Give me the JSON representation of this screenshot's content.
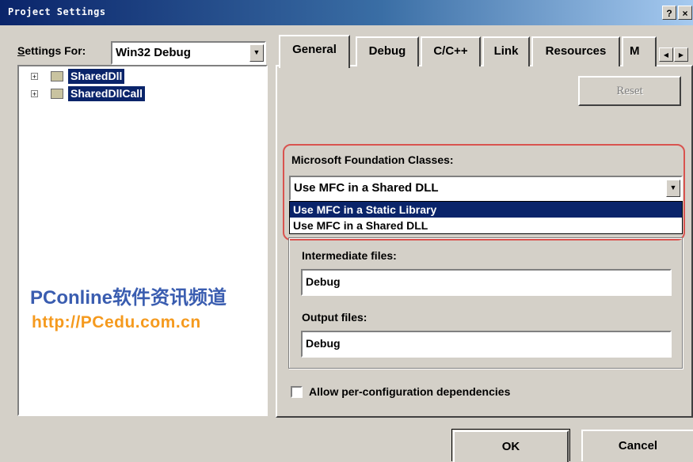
{
  "window": {
    "title": "Project Settings",
    "help_label": "?",
    "close_label": "×"
  },
  "left": {
    "settings_for_label": "Settings For:",
    "settings_for_value": "Win32 Debug",
    "tree": [
      {
        "label": "SharedDll"
      },
      {
        "label": "SharedDllCall"
      }
    ]
  },
  "watermark": {
    "line1": "PConline软件资讯频道",
    "line2": "http://PCedu.com.cn"
  },
  "tabs": [
    {
      "label": "General"
    },
    {
      "label": "Debug"
    },
    {
      "label": "C/C++"
    },
    {
      "label": "Link"
    },
    {
      "label": "Resources"
    },
    {
      "label": "M"
    }
  ],
  "general": {
    "reset_label": "Reset",
    "mfc_label": "Microsoft Foundation Classes:",
    "mfc_value": "Use MFC in a Shared DLL",
    "mfc_options": [
      {
        "label": "Use MFC in a Static Library",
        "highlighted": true
      },
      {
        "label": "Use MFC in a Shared DLL",
        "highlighted": false
      }
    ],
    "intermediate_label": "Intermediate files:",
    "intermediate_value": "Debug",
    "output_label": "Output files:",
    "output_value": "Debug",
    "allow_dependencies_label": "Allow per-configuration dependencies",
    "allow_dependencies_checked": false
  },
  "footer": {
    "ok_label": "OK",
    "cancel_label": "Cancel"
  },
  "colors": {
    "highlight": "#0a246a",
    "callout": "#d9534f",
    "watermark_blue": "#3a5db0",
    "watermark_orange": "#f59a1e"
  }
}
